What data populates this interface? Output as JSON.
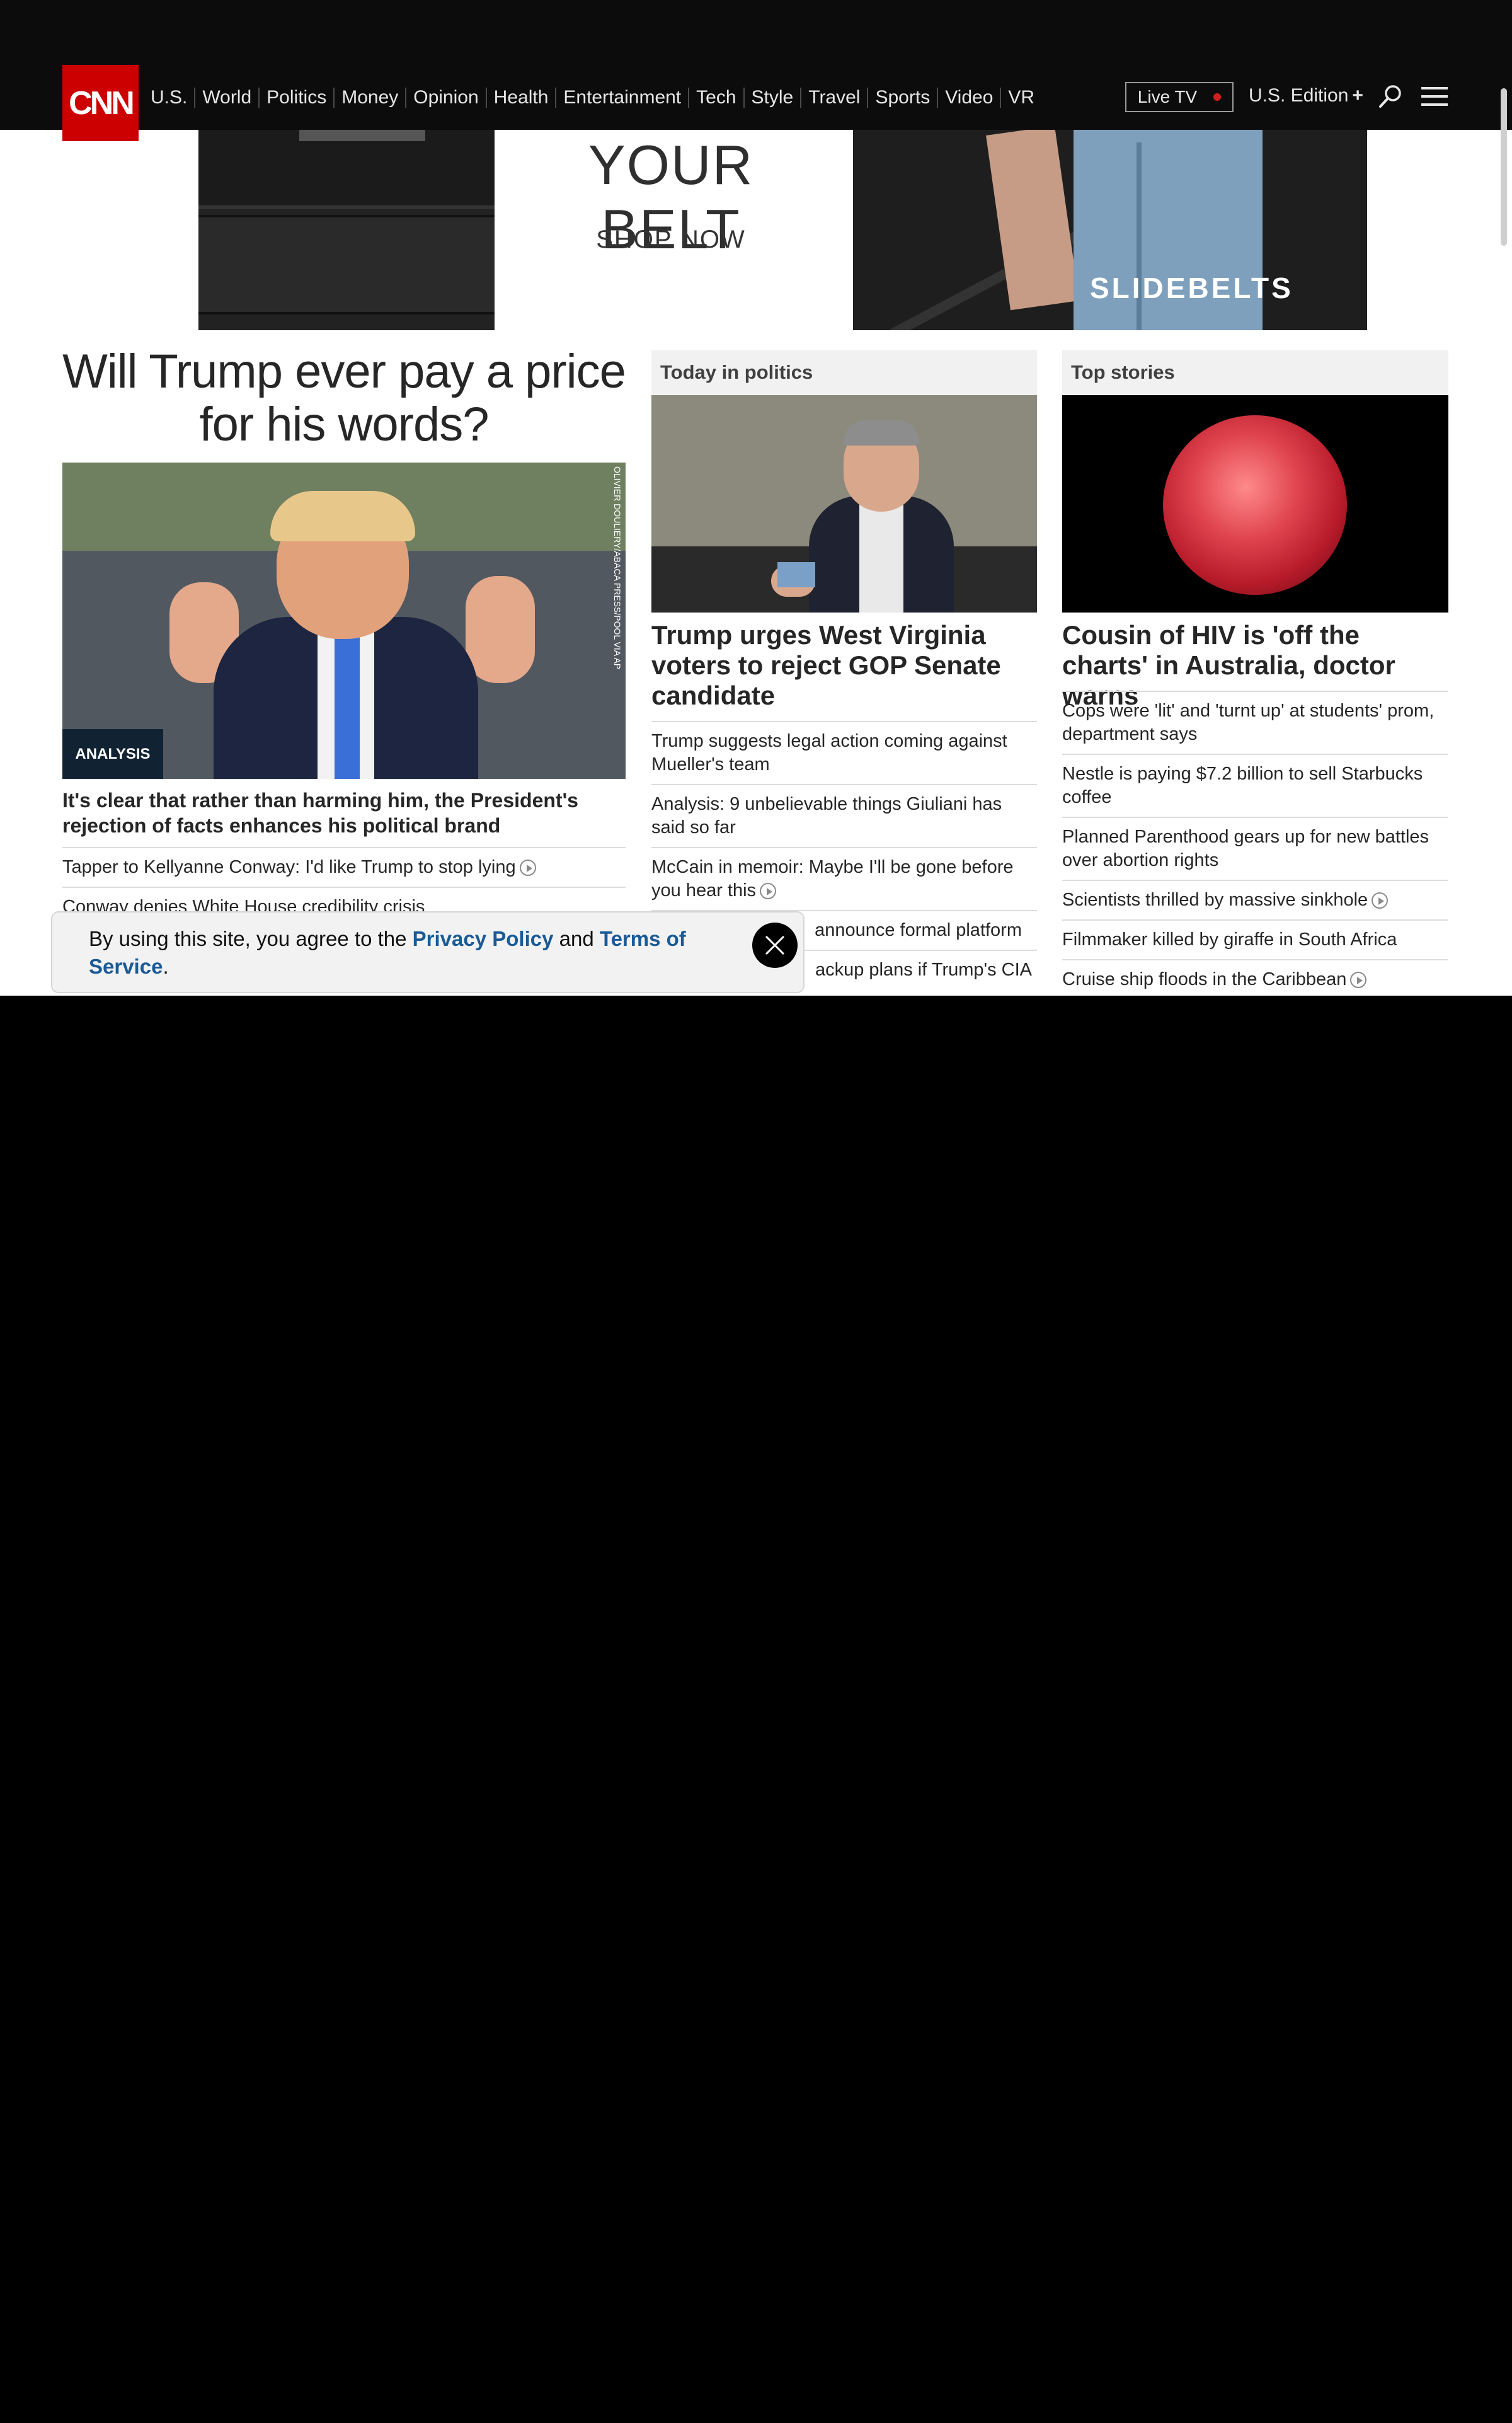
{
  "header": {
    "logo_text": "CNN",
    "nav": [
      "U.S.",
      "World",
      "Politics",
      "Money",
      "Opinion",
      "Health",
      "Entertainment",
      "Tech",
      "Style",
      "Travel",
      "Sports",
      "Video",
      "VR"
    ],
    "live_tv_label": "Live TV",
    "edition_label": "U.S. Edition",
    "edition_plus": "+"
  },
  "ad": {
    "headline": "YOUR BELT",
    "cta": "SHOP NOW",
    "brand": "SLIDEBELTS"
  },
  "lead": {
    "headline": "Will Trump ever pay a price for his words?",
    "badge": "ANALYSIS",
    "photo_credit": "OLIVIER DOULIERY/ABACA PRESS/POOL VIA AP",
    "title": "It's clear that rather than harming him, the President's rejection of facts enhances his political brand",
    "related": [
      {
        "text": "Tapper to Kellyanne Conway: I'd like Trump to stop lying",
        "video": true
      },
      {
        "text": "Conway denies White House credibility crisis",
        "video": false
      }
    ]
  },
  "politics": {
    "section_title": "Today in politics",
    "title": "Trump urges West Virginia voters to reject GOP Senate candidate",
    "items": [
      {
        "text": "Trump suggests legal action coming against Mueller's team",
        "video": false
      },
      {
        "text": "Analysis: 9 unbelievable things Giuliani has said so far",
        "video": false
      },
      {
        "text": "McCain in memoir: Maybe I'll be gone before you hear this",
        "video": true
      },
      {
        "text": "announce formal platform",
        "video": false
      },
      {
        "text": "ackup plans if Trump's CIA",
        "video": false
      }
    ]
  },
  "top": {
    "section_title": "Top stories",
    "title": "Cousin of HIV is 'off the charts' in Australia, doctor warns",
    "items": [
      {
        "text": "Cops were 'lit' and 'turnt up' at students' prom, department says",
        "video": false
      },
      {
        "text": "Nestle is paying $7.2 billion to sell Starbucks coffee",
        "video": false
      },
      {
        "text": "Planned Parenthood gears up for new battles over abortion rights",
        "video": false
      },
      {
        "text": "Scientists thrilled by massive sinkhole",
        "video": true
      },
      {
        "text": "Filmmaker killed by giraffe in South Africa",
        "video": false
      },
      {
        "text": "Cruise ship floods in the Caribbean",
        "video": true
      }
    ]
  },
  "cookie": {
    "prefix": "By using this site, you agree to the ",
    "privacy_link": "Privacy Policy",
    "middle": " and ",
    "terms_link": "Terms of Service",
    "suffix": "."
  },
  "colors": {
    "brand_red": "#cc0000",
    "nav_bg": "#0c0c0c",
    "link_blue": "#1a5a96",
    "live_dot": "#d01f1f"
  }
}
